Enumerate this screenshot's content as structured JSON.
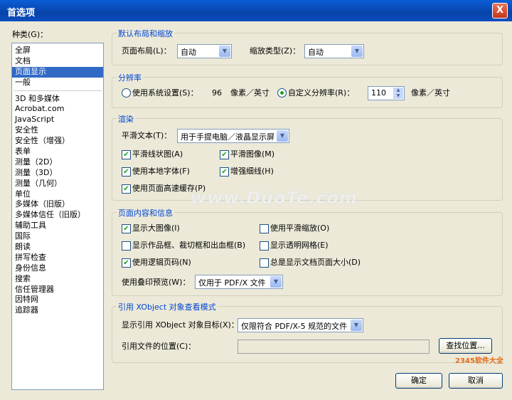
{
  "window": {
    "title": "首选项",
    "close": "X"
  },
  "categories": {
    "label": "种类(G)：",
    "group1": [
      "全屏",
      "文档",
      "页面显示",
      "一般"
    ],
    "group2": [
      "3D 和多媒体",
      "Acrobat.com",
      "JavaScript",
      "安全性",
      "安全性（增强）",
      "表单",
      "测量（2D）",
      "测量（3D）",
      "测量（几何）",
      "单位",
      "多媒体（旧版）",
      "多媒体信任（旧版）",
      "辅助工具",
      "国际",
      "朗读",
      "拼写检查",
      "身份信息",
      "搜索",
      "信任管理器",
      "因特网",
      "追踪器"
    ],
    "selected": "页面显示"
  },
  "layout": {
    "title": "默认布局和缩放",
    "page_layout_label": "页面布局(L)：",
    "page_layout_value": "自动",
    "zoom_label": "缩放类型(Z)：",
    "zoom_value": "自动"
  },
  "resolution": {
    "title": "分辨率",
    "system_label": "使用系统设置(S)：",
    "system_value": "96",
    "system_unit": "像素／英寸",
    "custom_label": "自定义分辨率(R)：",
    "custom_value": "110",
    "custom_unit": "像素／英寸"
  },
  "rendering": {
    "title": "渲染",
    "smooth_text_label": "平滑文本(T)：",
    "smooth_text_value": "用于手提电脑／液晶显示屏",
    "smooth_line_art": "平滑线状图(A)",
    "smooth_images": "平滑图像(M)",
    "local_fonts": "使用本地字体(F)",
    "enhance_thin_lines": "增强细线(H)",
    "page_cache": "使用页面高速缓存(P)"
  },
  "page_content": {
    "title": "页面内容和信息",
    "show_large_images": "显示大图像(I)",
    "smooth_zoom": "使用平滑缩放(O)",
    "show_art_trim": "显示作品框、裁切框和出血框(B)",
    "show_transparency_grid": "显示透明网格(E)",
    "logical_page_numbers": "使用逻辑页码(N)",
    "show_page_size": "总是显示文档页面大小(D)",
    "overprint_label": "使用叠印预览(W)：",
    "overprint_value": "仅用于 PDF/X 文件"
  },
  "xobject": {
    "title": "引用 XObject 对象查看模式",
    "target_label": "显示引用 XObject 对象目标(X)：",
    "target_value": "仅限符合 PDF/X-5 规范的文件",
    "location_label": "引用文件的位置(C)：",
    "location_value": "",
    "browse_button": "查找位置..."
  },
  "footer": {
    "ok_button": "确定",
    "cancel_button": "取消"
  },
  "watermarks": {
    "center": "www.DuoTe.com",
    "corner": "2345软件大全"
  }
}
